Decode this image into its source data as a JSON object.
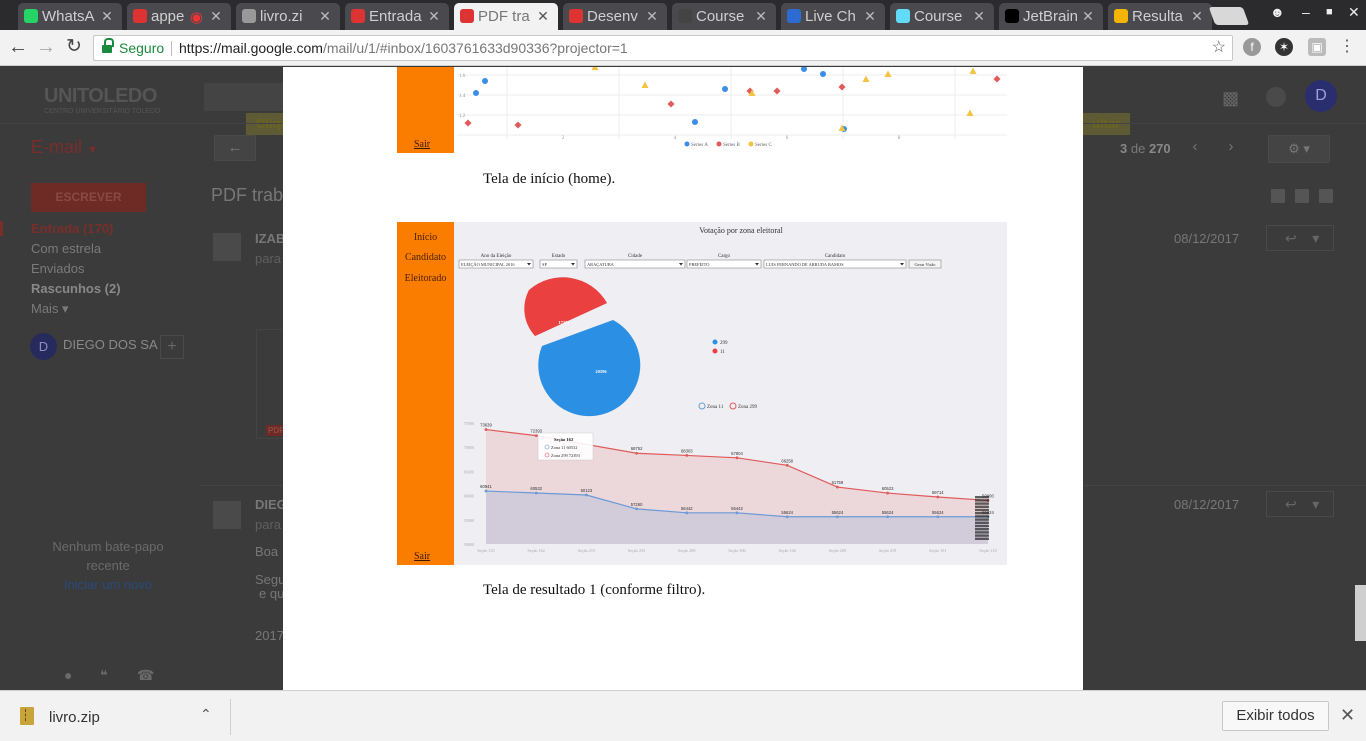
{
  "browser": {
    "tabs": [
      {
        "label": "WhatsA",
        "icon": "whatsapp-icon",
        "color": "#25d366"
      },
      {
        "label": "appe",
        "icon": "app-icon",
        "color": "#d33",
        "recording": true
      },
      {
        "label": "livro.zi",
        "icon": "document-icon",
        "color": "#999"
      },
      {
        "label": "Entrada",
        "icon": "gmail-icon",
        "color": "#d33"
      },
      {
        "label": "PDF tra",
        "icon": "gmail-icon",
        "color": "#d33",
        "active": true
      },
      {
        "label": "Desenv",
        "icon": "udemy-icon",
        "color": "#d33"
      },
      {
        "label": "Course",
        "icon": "course-icon",
        "color": "#444"
      },
      {
        "label": "Live Ch",
        "icon": "live-chat-icon",
        "color": "#2d6bd3"
      },
      {
        "label": "Course",
        "icon": "react-icon",
        "color": "#61dafb"
      },
      {
        "label": "JetBrain",
        "icon": "jetbrains-icon",
        "color": "#000"
      },
      {
        "label": "Resulta",
        "icon": "google-drive-icon",
        "color": "#f4b400"
      }
    ],
    "address": {
      "secure_label": "Seguro",
      "url_host": "https://mail.google.com",
      "url_path": "/mail/u/1/#inbox/1603761633d90336?projector=1"
    }
  },
  "gmail": {
    "logo": "UNITOLEDO",
    "logo_sub": "CENTRO UNIVERSITÁRIO TOLEDO",
    "email_label": "E-mail",
    "compose_label": "ESCREVER",
    "subject": "PDF trab",
    "banner_left": "Cliqu",
    "banner_right": "ultar",
    "pager": {
      "current": "3",
      "of_label": "de",
      "total": "270"
    },
    "avatar_letter": "D",
    "nav": [
      {
        "label": "Entrada (170)",
        "state": "active"
      },
      {
        "label": "Com estrela"
      },
      {
        "label": "Enviados"
      },
      {
        "label": "Rascunhos (2)",
        "state": "bold"
      },
      {
        "label": "Mais ▾"
      }
    ],
    "contact": {
      "letter": "D",
      "name": "DIEGO DOS SA"
    },
    "chat": {
      "line1": "Nenhum bate-papo",
      "line2": "recente",
      "link": "Iniciar um novo"
    },
    "messages": [
      {
        "name": "IZAB",
        "to": "para",
        "date": "08/12/2017"
      },
      {
        "name": "DIEG",
        "to": "para",
        "date": "08/12/2017",
        "body1": "Boa",
        "body2": "Segu",
        "body3": "e qu",
        "body4": "2017"
      }
    ],
    "attachment_badge": "PDF"
  },
  "pdf": {
    "figure1": {
      "sair": "Sair",
      "legend": [
        "Series A",
        "Series B",
        "Series C"
      ],
      "ticks_y": [
        "1.6",
        "1.4",
        "1.2"
      ],
      "ticks_x": [
        "2",
        "4",
        "6",
        "8"
      ]
    },
    "caption1": "Tela de início (home).",
    "figure2": {
      "menu": [
        "Início",
        "Candidato",
        "Eleitorado"
      ],
      "sair": "Sair",
      "title": "Votação por zona eleitoral",
      "filters": [
        {
          "label": "Ano da Eleição",
          "value": "ELEIÇÃO MUNICIPAL 2016"
        },
        {
          "label": "Estado",
          "value": "SP"
        },
        {
          "label": "Cidade",
          "value": "ARAÇATUBA"
        },
        {
          "label": "Cargo",
          "value": "PREFEITO"
        },
        {
          "label": "Candidato",
          "value": "LUIS FERNANDO DE ARRUDA RAMOS"
        }
      ],
      "button": "Gerar Visão",
      "pie": {
        "labels": [
          "17251",
          "20596"
        ],
        "legend": [
          "299",
          "11"
        ]
      },
      "line_legend": [
        "Zona 11",
        "Zona 299"
      ],
      "tooltip": {
        "title": "Seção 162",
        "row1": "Zona 11 60532",
        "row2": "Zona 299 72393"
      }
    },
    "caption2": "Tela de resultado 1 (conforme filtro)."
  },
  "chart_data": {
    "type": "line",
    "title": "Votação por zona eleitoral",
    "categories": [
      "Seção 153",
      "Seção 162",
      "Seção 219",
      "Seção 235",
      "Seção 289",
      "Seção 306",
      "Seção 146",
      "Seção 209",
      "Seção 219",
      "Seção 101",
      "Seção 118"
    ],
    "series": [
      {
        "name": "Zona 299",
        "color": "#e05a5a",
        "values": [
          73639,
          72393,
          null,
          68752,
          68303,
          67804,
          66258,
          61759,
          60523,
          59714,
          59000
        ]
      },
      {
        "name": "Zona 11",
        "color": "#6a9ad8",
        "values": [
          60941,
          60532,
          60123,
          57260,
          56442,
          56442,
          55624,
          55624,
          55624,
          55624,
          55624
        ]
      }
    ],
    "ylim": [
      50000,
      75000
    ],
    "yticks": [
      "75000",
      "70000",
      "65000",
      "60000",
      "55000",
      "50000"
    ]
  },
  "downloads": {
    "file": "livro.zip",
    "show_all": "Exibir todos"
  }
}
